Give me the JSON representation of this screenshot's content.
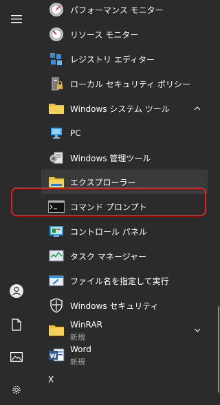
{
  "rail": {
    "menu_icon": "hamburger-icon",
    "user_icon": "user-icon",
    "documents_icon": "document-icon",
    "pictures_icon": "picture-icon",
    "settings_icon": "gear-icon"
  },
  "items": [
    {
      "label": "パフォーマンス モニター",
      "icon": "performance-monitor-icon"
    },
    {
      "label": "リソース モニター",
      "icon": "resource-monitor-icon"
    },
    {
      "label": "レジストリ エディター",
      "icon": "registry-editor-icon"
    },
    {
      "label": "ローカル セキュリティ ポリシー",
      "icon": "local-security-policy-icon"
    },
    {
      "label": "Windows システム ツール",
      "icon": "folder-icon"
    },
    {
      "label": "PC",
      "icon": "pc-icon"
    },
    {
      "label": "Windows 管理ツール",
      "icon": "admin-tools-icon"
    },
    {
      "label": "エクスプローラー",
      "icon": "file-explorer-icon"
    },
    {
      "label": "コマンド プロンプト",
      "icon": "command-prompt-icon"
    },
    {
      "label": "コントロール パネル",
      "icon": "control-panel-icon"
    },
    {
      "label": "タスク マネージャー",
      "icon": "task-manager-icon"
    },
    {
      "label": "ファイル名を指定して実行",
      "icon": "run-icon"
    },
    {
      "label": "Windows セキュリティ",
      "icon": "shield-icon"
    },
    {
      "label": "WinRAR",
      "sub": "新規",
      "icon": "folder-icon"
    },
    {
      "label": "Word",
      "sub": "新規",
      "icon": "word-icon"
    }
  ],
  "section_letter": "X",
  "colors": {
    "accent": "#0078d7",
    "highlight": "#3a3a3a",
    "callout": "#e02020",
    "folder": "#f0c232"
  }
}
